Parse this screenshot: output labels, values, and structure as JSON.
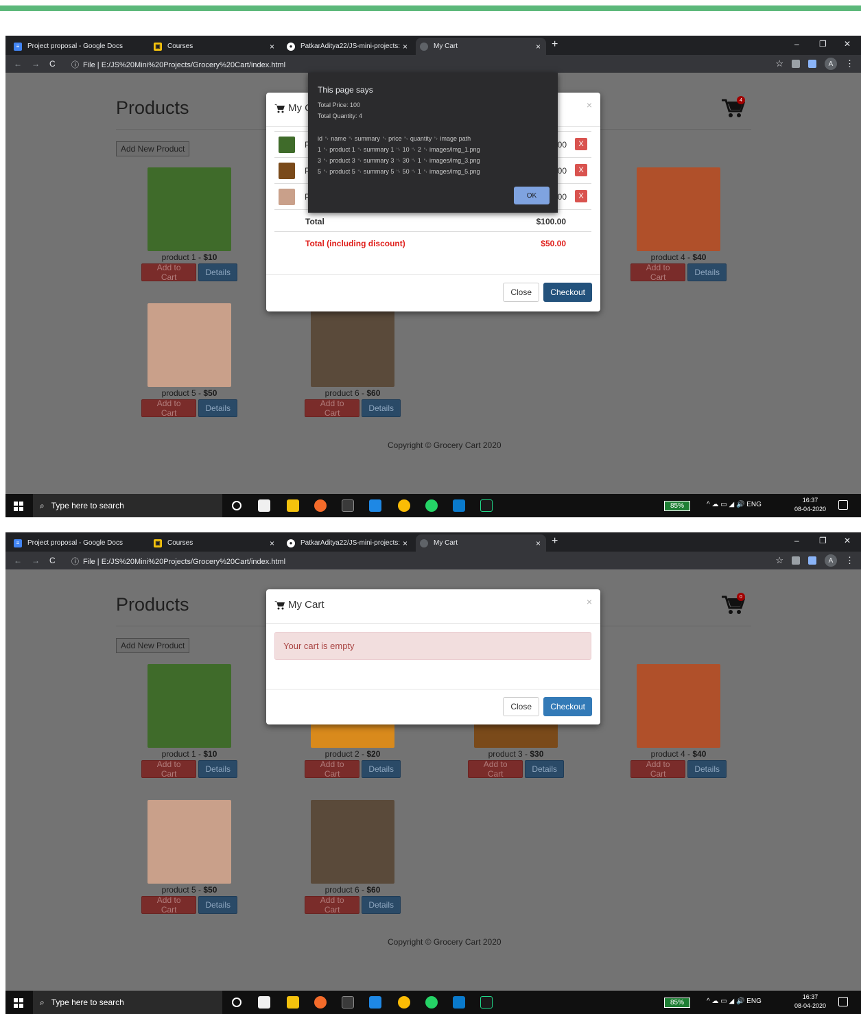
{
  "browser": {
    "tabs": [
      {
        "label": "Project proposal - Google Docs",
        "icon": "docs-icon"
      },
      {
        "label": "Courses",
        "icon": "courses-icon"
      },
      {
        "label": "PatkarAditya22/JS-mini-projects:",
        "icon": "github-icon"
      },
      {
        "label": "My Cart",
        "icon": "globe-icon"
      }
    ],
    "new_tab": "+",
    "window_controls": [
      "–",
      "❐",
      "✕"
    ],
    "url_prefix": "File",
    "url": "E:/JS%20Mini%20Projects/Grocery%20Cart/index.html",
    "avatar": "A"
  },
  "page": {
    "title": "Products",
    "add_new_label": "Add New Product",
    "add_to_cart_label": "Add to Cart",
    "details_label": "Details",
    "products": [
      {
        "name": "product 1",
        "price": "$10",
        "color": "#3f6b2a"
      },
      {
        "name": "product 2",
        "price": "$20",
        "color": "#d98a1c"
      },
      {
        "name": "product 3",
        "price": "$30",
        "color": "#7a4a1a"
      },
      {
        "name": "product 4",
        "price": "$40",
        "color": "#b0502a"
      },
      {
        "name": "product 5",
        "price": "$50",
        "color": "#c9a08a"
      },
      {
        "name": "product 6",
        "price": "$60",
        "color": "#5a4a3a"
      }
    ],
    "copyright": "Copyright © Grocery Cart 2020"
  },
  "screen1": {
    "cart_count": "4",
    "modal": {
      "title": "My C",
      "rows": [
        {
          "name": "P",
          "price": "00",
          "delete": "X"
        },
        {
          "name": "P",
          "price": "00",
          "delete": "X"
        },
        {
          "name": "P",
          "price": "00",
          "delete": "X"
        }
      ],
      "total_label": "Total",
      "total_value": "$100.00",
      "discount_label": "Total (including discount)",
      "discount_value": "$50.00",
      "close_label": "Close",
      "checkout_label": "Checkout"
    },
    "alert": {
      "title": "This page says",
      "lines": [
        "Total Price: 100",
        "Total Quantity: 4",
        "id ␉ name ␉ summary ␉ price ␉ quantity ␉ image path",
        "1 ␉ product 1 ␉ summary 1 ␉ 10 ␉ 2 ␉ images/img_1.png",
        "3 ␉ product 3 ␉ summary 3 ␉ 30 ␉ 1 ␉ images/img_3.png",
        "5 ␉ product 5 ␉ summary 5 ␉ 50 ␉ 1 ␉ images/img_5.png"
      ],
      "ok_label": "OK"
    }
  },
  "screen2": {
    "cart_count": "0",
    "modal": {
      "title": "My Cart",
      "empty_message": "Your cart is empty",
      "close_label": "Close",
      "checkout_label": "Checkout"
    }
  },
  "taskbar": {
    "search_placeholder": "Type here to search",
    "battery": "85%",
    "tray": "^ ☁ ▭ ◢ 🔊 ENG",
    "time": "16:37",
    "date": "08-04-2020"
  }
}
